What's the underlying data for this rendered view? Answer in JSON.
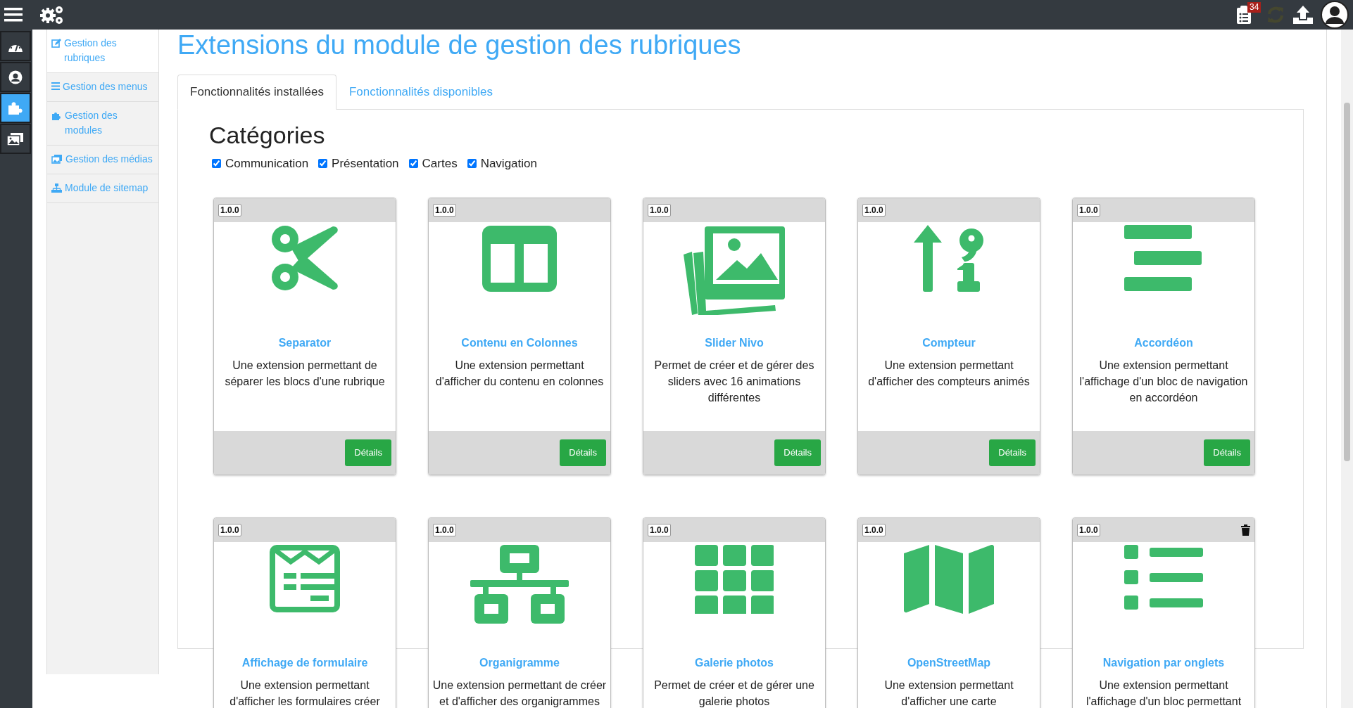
{
  "topbar": {
    "notification_count": "34"
  },
  "rail": [
    {
      "selected": false
    },
    {
      "selected": false
    },
    {
      "selected": true
    },
    {
      "selected": false
    }
  ],
  "sidebar": {
    "items": [
      {
        "label": "Gestion des rubriques",
        "selected": true
      },
      {
        "label": "Gestion des menus",
        "selected": false
      },
      {
        "label": "Gestion des modules",
        "selected": false
      },
      {
        "label": "Gestion des médias",
        "selected": false
      },
      {
        "label": "Module de sitemap",
        "selected": false
      }
    ]
  },
  "page_title": "Extensions du module de gestion des rubriques",
  "tabs": [
    {
      "label": "Fonctionnalités installées",
      "selected": true
    },
    {
      "label": "Fonctionnalités disponibles",
      "selected": false
    }
  ],
  "categories": {
    "title": "Catégories",
    "filters": [
      {
        "label": "Communication",
        "checked": true
      },
      {
        "label": "Présentation",
        "checked": true
      },
      {
        "label": "Cartes",
        "checked": true
      },
      {
        "label": "Navigation",
        "checked": true
      }
    ]
  },
  "extensions": [
    {
      "version": "1.0.0",
      "title": "Separator",
      "description": "Une extension permettant de séparer les blocs d'une rubrique",
      "button": "Détails",
      "deletable": false
    },
    {
      "version": "1.0.0",
      "title": "Contenu en Colonnes",
      "description": "Une extension permettant d'afficher du contenu en colonnes",
      "button": "Détails",
      "deletable": false
    },
    {
      "version": "1.0.0",
      "title": "Slider Nivo",
      "description": "Permet de créer et de gérer des sliders avec 16 animations différentes",
      "button": "Détails",
      "deletable": false
    },
    {
      "version": "1.0.0",
      "title": "Compteur",
      "description": "Une extension permettant d'afficher des compteurs animés",
      "button": "Détails",
      "deletable": false
    },
    {
      "version": "1.0.0",
      "title": "Accordéon",
      "description": "Une extension permettant l'affichage d'un bloc de navigation en accordéon",
      "button": "Détails",
      "deletable": false
    },
    {
      "version": "1.0.0",
      "title": "Affichage de formulaire",
      "description": "Une extension permettant d'afficher les formulaires créer",
      "deletable": false
    },
    {
      "version": "1.0.0",
      "title": "Organigramme",
      "description": "Une extension permettant de créer et d'afficher des organigrammes",
      "deletable": false
    },
    {
      "version": "1.0.0",
      "title": "Galerie photos",
      "description": "Permet de créer et de gérer une galerie photos",
      "deletable": false
    },
    {
      "version": "1.0.0",
      "title": "OpenStreetMap",
      "description": "Une extension permettant d'afficher une carte",
      "deletable": false
    },
    {
      "version": "1.0.0",
      "title": "Navigation par onglets",
      "description": "Une extension permettant l'affichage d'un bloc permettant",
      "deletable": true
    }
  ]
}
